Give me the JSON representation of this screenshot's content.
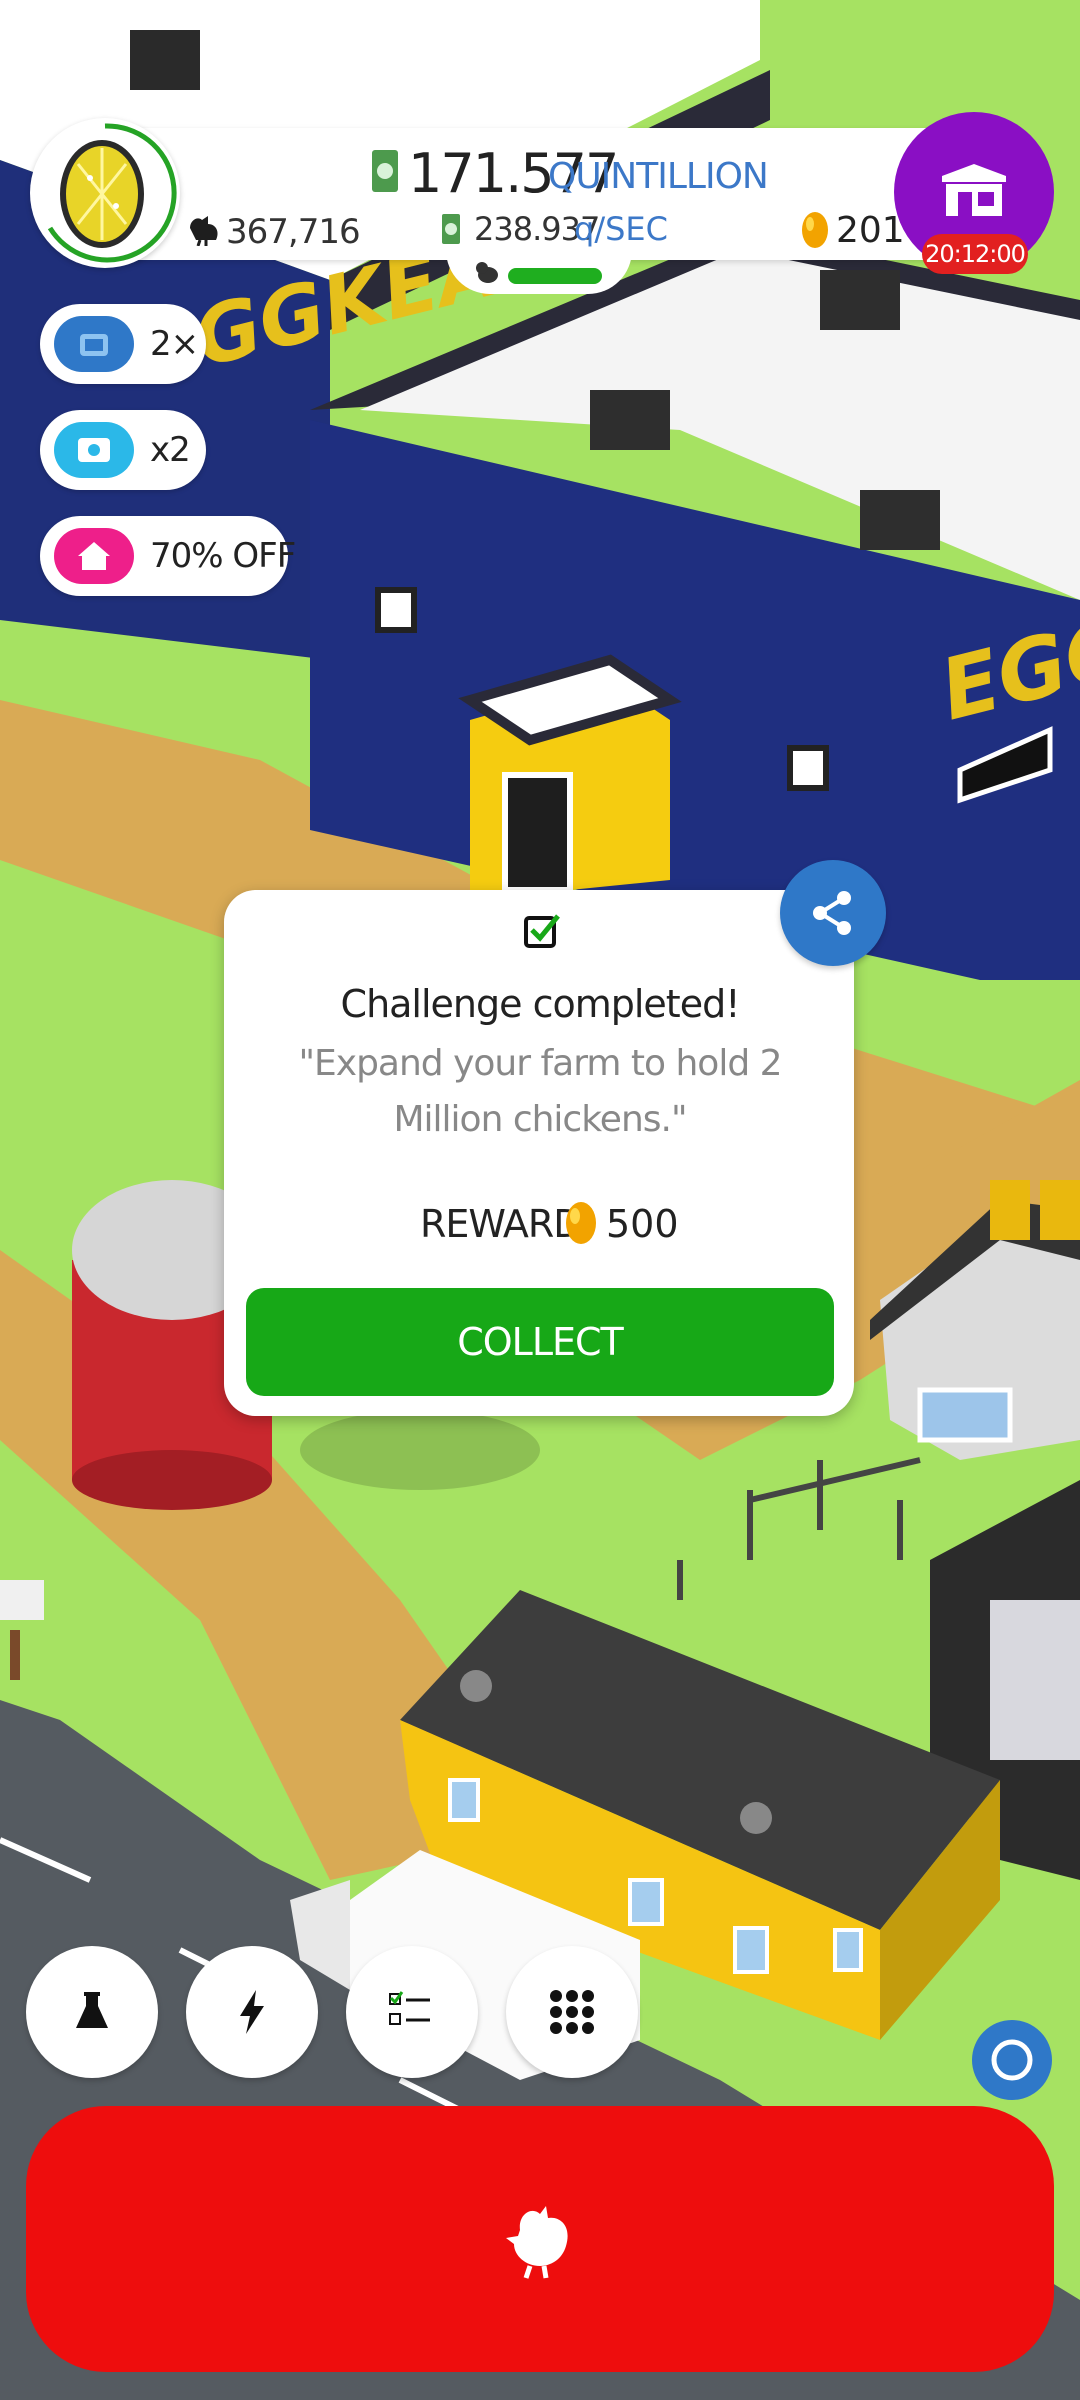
{
  "hud": {
    "money": "171.577",
    "money_unit": "QUINTILLION",
    "rate": "238.937",
    "rate_unit": "q/SEC",
    "chickens": "367,716",
    "golden_eggs": "201",
    "shop_timer": "20:12:00"
  },
  "boosts": [
    {
      "label": "2×",
      "icon": "tv-ad-icon",
      "color": "#2f78c8"
    },
    {
      "label": "x2",
      "icon": "money-boost-icon",
      "color": "#2bb8e8"
    },
    {
      "label": "70% OFF",
      "icon": "home-sale-icon",
      "color": "#ee1f8a"
    }
  ],
  "scene_text": {
    "building_sign": "EGGKEA",
    "building_sign_2": "EGG"
  },
  "dialog": {
    "title": "Challenge completed!",
    "description": "\"Expand your farm to hold 2 Million chickens.\"",
    "reward_label": "REWARD:",
    "reward_value": "500",
    "collect_label": "COLLECT"
  },
  "bottom_nav": [
    {
      "name": "research-button",
      "icon": "flask-icon"
    },
    {
      "name": "boosts-button",
      "icon": "lightning-icon"
    },
    {
      "name": "missions-button",
      "icon": "checklist-icon"
    },
    {
      "name": "menu-button",
      "icon": "grid-icon"
    }
  ],
  "colors": {
    "grass": "#a6e262",
    "hatch_button": "#ee0d0d",
    "collect_button": "#17a817",
    "shop_button": "#8a0fc4",
    "share_button": "#2f78c8",
    "money_unit": "#3c78c8"
  }
}
